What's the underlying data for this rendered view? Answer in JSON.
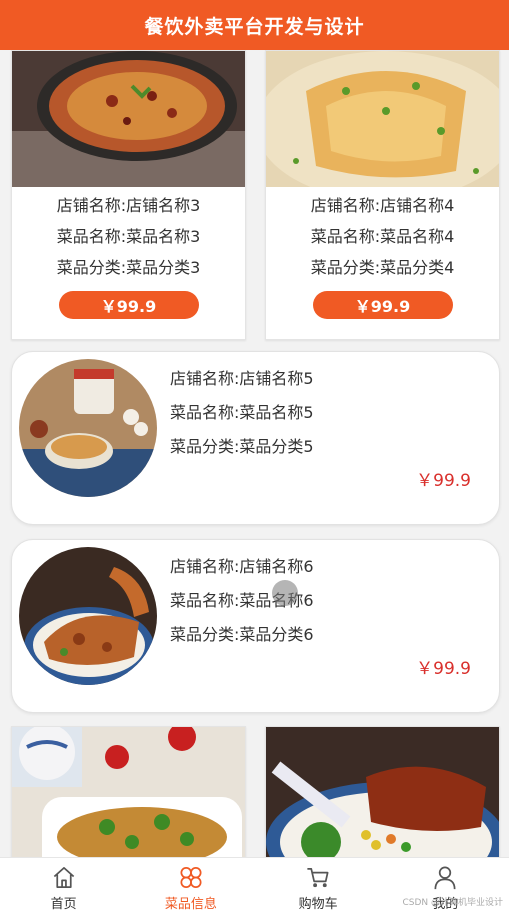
{
  "header": {
    "title": "餐饮外卖平台开发与设计"
  },
  "grid_top": [
    {
      "shop": "店铺名称:店铺名称3",
      "dish": "菜品名称:菜品名称3",
      "category": "菜品分类:菜品分类3",
      "price": "￥99.9"
    },
    {
      "shop": "店铺名称:店铺名称4",
      "dish": "菜品名称:菜品名称4",
      "category": "菜品分类:菜品分类4",
      "price": "￥99.9"
    }
  ],
  "list": [
    {
      "shop": "店铺名称:店铺名称5",
      "dish": "菜品名称:菜品名称5",
      "category": "菜品分类:菜品分类5",
      "price": "￥99.9"
    },
    {
      "shop": "店铺名称:店铺名称6",
      "dish": "菜品名称:菜品名称6",
      "category": "菜品分类:菜品分类6",
      "price": "￥99.9"
    }
  ],
  "tabbar": [
    {
      "label": "首页",
      "icon": "home-icon"
    },
    {
      "label": "菜品信息",
      "icon": "clover-icon"
    },
    {
      "label": "购物车",
      "icon": "cart-icon"
    },
    {
      "label": "我的",
      "icon": "user-icon"
    }
  ],
  "watermark": "CSDN @计算机毕业设计",
  "colors": {
    "accent": "#f05a24",
    "price_red": "#d9302c"
  }
}
